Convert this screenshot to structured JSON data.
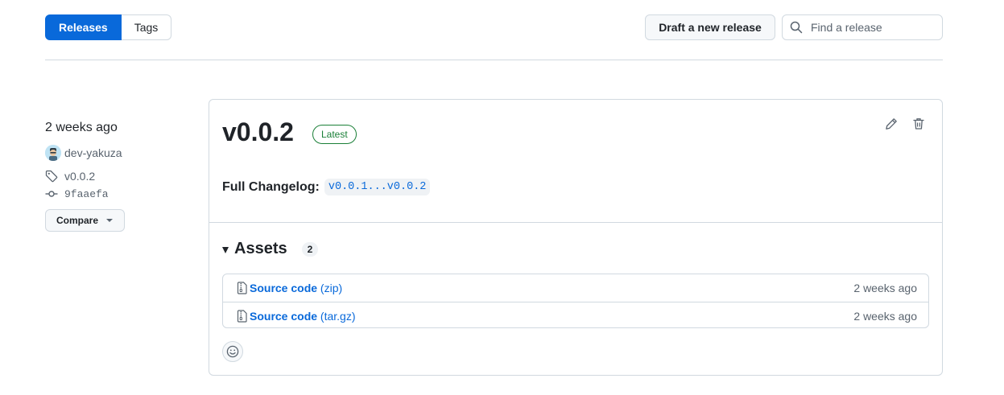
{
  "nav": {
    "releases_tab": "Releases",
    "tags_tab": "Tags",
    "draft_button": "Draft a new release",
    "search_placeholder": "Find a release"
  },
  "sidebar": {
    "date": "2 weeks ago",
    "author": "dev-yakuza",
    "tag": "v0.0.2",
    "commit": "9faaefa",
    "compare_button": "Compare"
  },
  "release": {
    "title": "v0.0.2",
    "badge": "Latest",
    "changelog_label": "Full Changelog:",
    "changelog_link": "v0.0.1...v0.0.2",
    "assets": {
      "heading": "Assets",
      "count": "2",
      "items": [
        {
          "name": "Source code",
          "ext": "(zip)",
          "date": "2 weeks ago"
        },
        {
          "name": "Source code",
          "ext": "(tar.gz)",
          "date": "2 weeks ago"
        }
      ]
    }
  },
  "icons": {
    "search": "search-icon",
    "tag": "tag-icon",
    "commit": "git-commit-icon",
    "edit": "pencil-icon",
    "delete": "trash-icon",
    "zip": "file-zip-icon",
    "reaction": "smiley-icon"
  },
  "colors": {
    "accent": "#0969da",
    "success": "#1a7f37",
    "border": "#d1d9e0",
    "muted": "#59636e"
  }
}
